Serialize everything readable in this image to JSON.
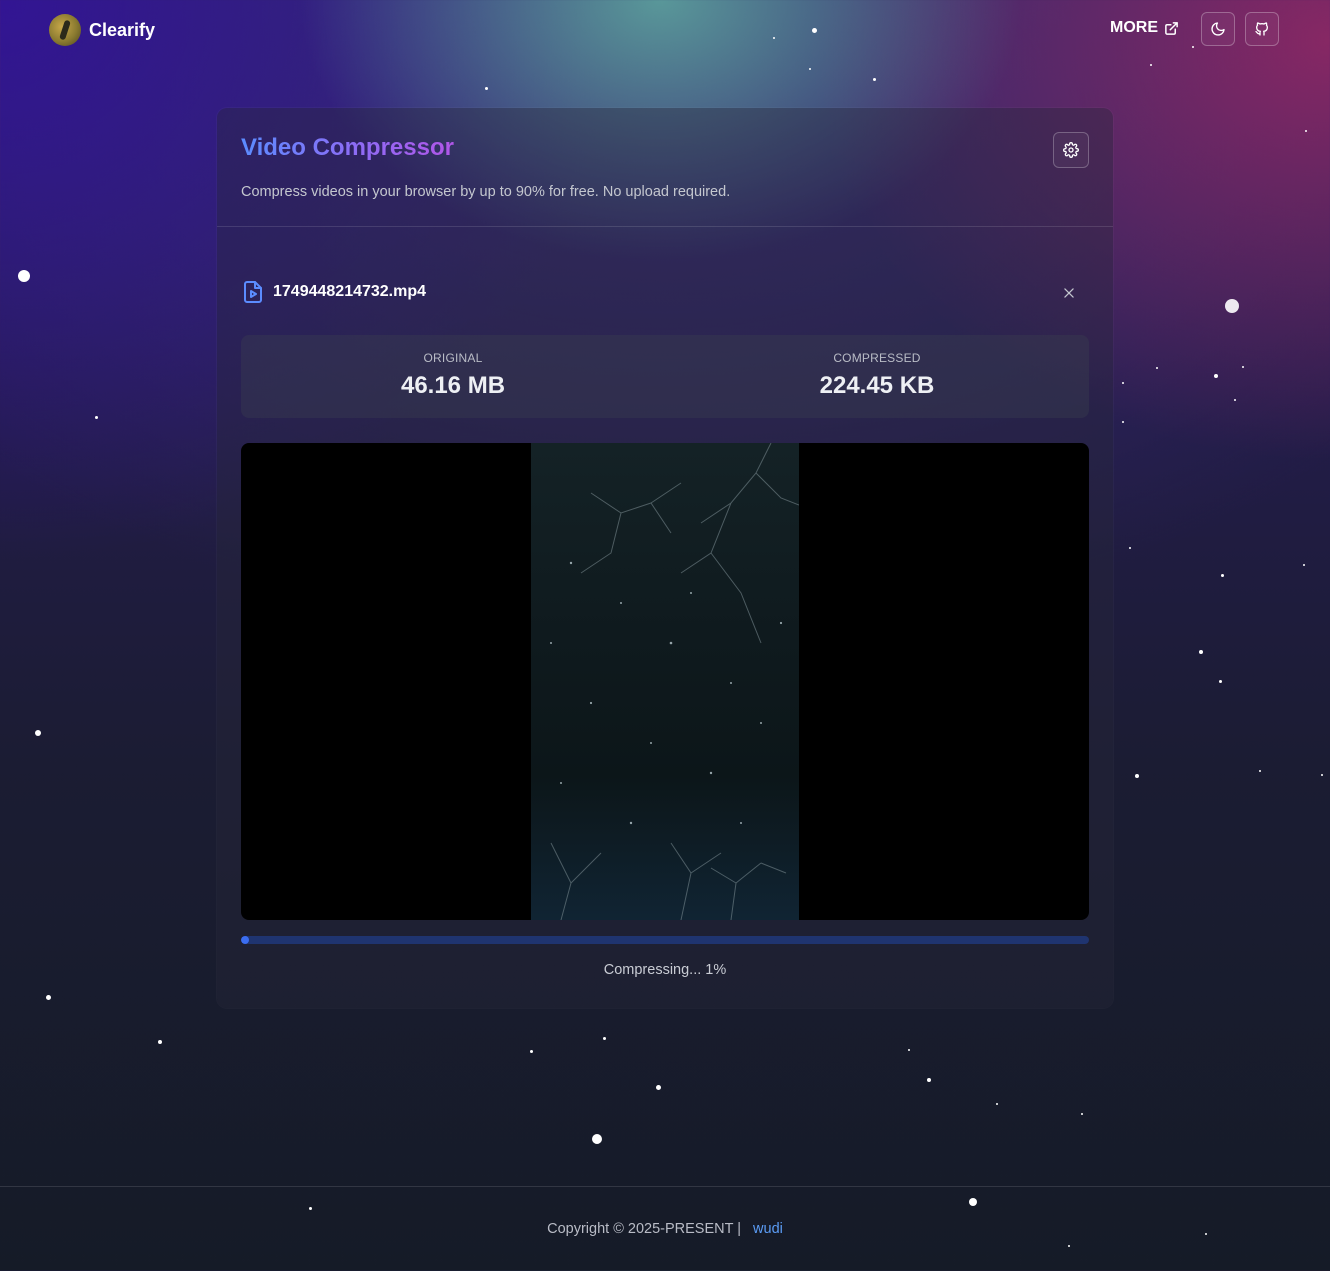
{
  "header": {
    "brand_name": "Clearify",
    "more_label": "MORE"
  },
  "card": {
    "title": "Video Compressor",
    "subtitle": "Compress videos in your browser by up to 90% for free. No upload required."
  },
  "file": {
    "name": "1749448214732.mp4"
  },
  "stats": {
    "original_label": "ORIGINAL",
    "original_value": "46.16 MB",
    "compressed_label": "COMPRESSED",
    "compressed_value": "224.45 KB"
  },
  "progress": {
    "percent": 1,
    "text": "Compressing... 1%"
  },
  "footer": {
    "copyright": "Copyright © 2025-PRESENT |",
    "author": "wudi"
  },
  "icons": {
    "brand": "avatar-logo-icon",
    "more": "external-link-icon",
    "theme": "moon-icon",
    "repo": "github-icon",
    "settings": "gear-icon",
    "file": "file-video-icon",
    "remove": "close-icon"
  },
  "colors": {
    "title_gradient_start": "#5b8cff",
    "title_gradient_end": "#b156e8",
    "progress_track": "#1f3470",
    "progress_fill": "#3b6df0",
    "link": "#5b9cf5"
  }
}
